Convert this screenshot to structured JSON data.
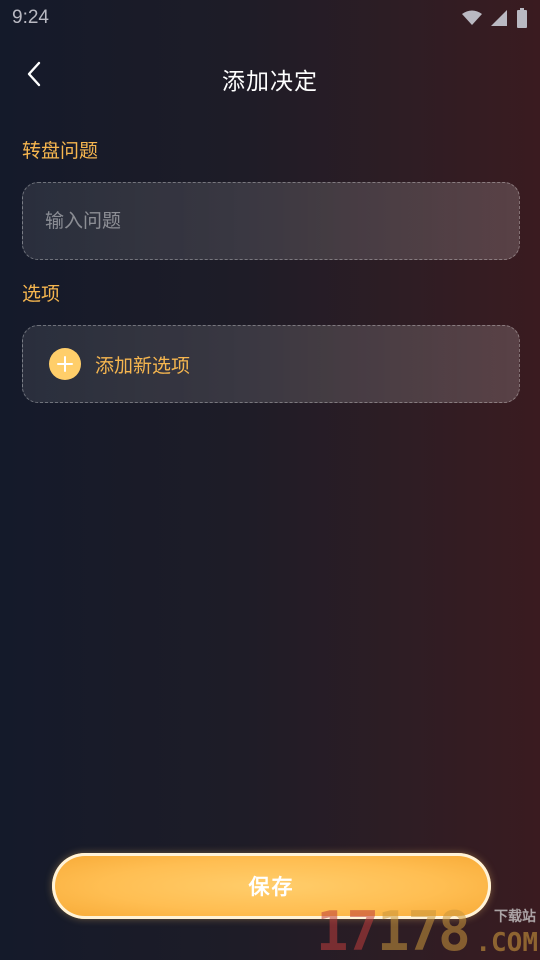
{
  "status_bar": {
    "time": "9:24",
    "icons": [
      "wifi-icon",
      "signal-icon",
      "battery-icon"
    ]
  },
  "header": {
    "back_icon": "chevron-left-icon",
    "title": "添加决定"
  },
  "question_section": {
    "label": "转盘问题",
    "input_value": "",
    "input_placeholder": "输入问题"
  },
  "options_section": {
    "label": "选项",
    "add_icon": "plus-circle-icon",
    "add_label": "添加新选项"
  },
  "footer": {
    "save_label": "保存"
  },
  "watermark": {
    "digits": [
      "1",
      "7",
      "1",
      "7",
      "8"
    ],
    "top_text": "下载站",
    "domain_text": ".COM"
  },
  "colors": {
    "accent": "#f6b64f",
    "button": "#ffbe52",
    "plus_circle": "#ffce6a",
    "background_left": "#141a2a",
    "background_right": "#3a1b20"
  }
}
